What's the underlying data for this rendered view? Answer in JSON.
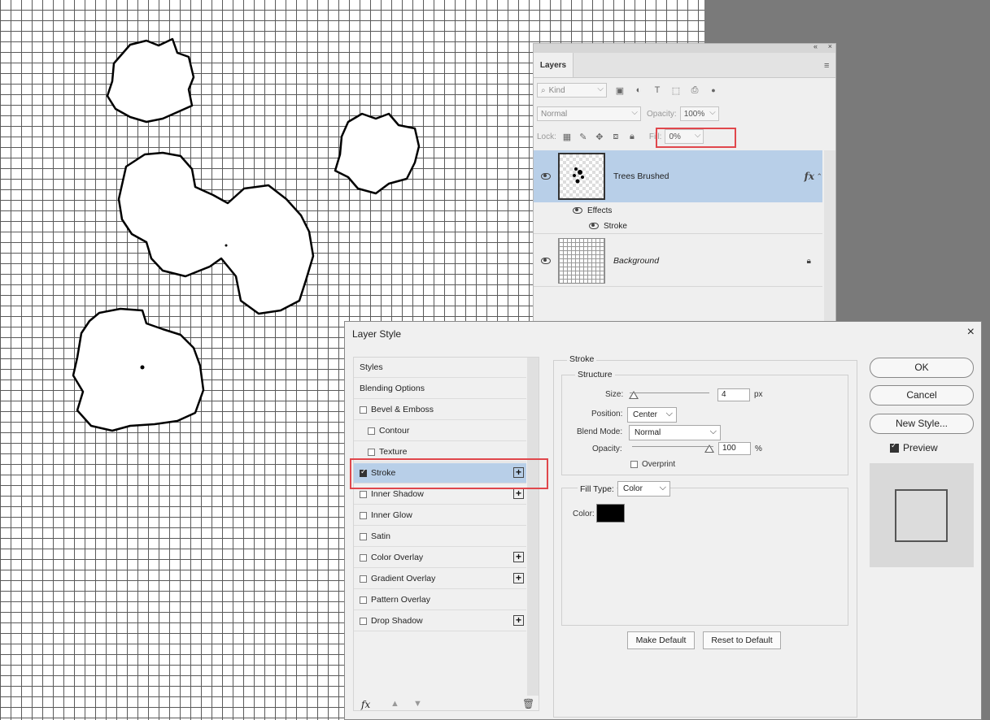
{
  "layers_panel": {
    "title": "Layers",
    "topbar_collapse": "«",
    "topbar_close": "×",
    "filter_kind": "Kind",
    "blend_mode": "Normal",
    "opacity_label": "Opacity:",
    "opacity_value": "100%",
    "lock_label": "Lock:",
    "fill_label": "Fill:",
    "fill_value": "0%",
    "layers": [
      {
        "name": "Trees Brushed",
        "selected": true,
        "fx": "fx",
        "effects_label": "Effects",
        "effect": "Stroke"
      },
      {
        "name": "Background",
        "selected": false
      }
    ]
  },
  "dialog": {
    "title": "Layer Style",
    "styles_list": [
      {
        "label": "Styles",
        "checkbox": false,
        "plus": false
      },
      {
        "label": "Blending Options",
        "checkbox": false,
        "plus": false
      },
      {
        "label": "Bevel & Emboss",
        "checkbox": true,
        "checked": false,
        "plus": false
      },
      {
        "label": "Contour",
        "checkbox": true,
        "checked": false,
        "plus": false
      },
      {
        "label": "Texture",
        "checkbox": true,
        "checked": false,
        "plus": false
      },
      {
        "label": "Stroke",
        "checkbox": true,
        "checked": true,
        "plus": true,
        "active": true
      },
      {
        "label": "Inner Shadow",
        "checkbox": true,
        "checked": false,
        "plus": true
      },
      {
        "label": "Inner Glow",
        "checkbox": true,
        "checked": false,
        "plus": false
      },
      {
        "label": "Satin",
        "checkbox": true,
        "checked": false,
        "plus": false
      },
      {
        "label": "Color Overlay",
        "checkbox": true,
        "checked": false,
        "plus": true
      },
      {
        "label": "Gradient Overlay",
        "checkbox": true,
        "checked": false,
        "plus": true
      },
      {
        "label": "Pattern Overlay",
        "checkbox": true,
        "checked": false,
        "plus": false
      },
      {
        "label": "Drop Shadow",
        "checkbox": true,
        "checked": false,
        "plus": true
      }
    ],
    "stroke": {
      "section_title": "Stroke",
      "structure_title": "Structure",
      "size_label": "Size:",
      "size_value": "4",
      "size_unit": "px",
      "position_label": "Position:",
      "position_value": "Center",
      "blend_mode_label": "Blend Mode:",
      "blend_mode_value": "Normal",
      "opacity_label": "Opacity:",
      "opacity_value": "100",
      "opacity_unit": "%",
      "overprint_label": "Overprint",
      "fill_type_label": "Fill Type:",
      "fill_type_value": "Color",
      "color_label": "Color:",
      "color_value": "#000000",
      "make_default": "Make Default",
      "reset_default": "Reset to Default"
    },
    "buttons": {
      "ok": "OK",
      "cancel": "Cancel",
      "new_style": "New Style...",
      "preview": "Preview"
    },
    "preview_checked": true,
    "close_icon": "×"
  },
  "colors": {
    "selection": "#b8cfe8",
    "highlight_box": "#e0474c"
  }
}
